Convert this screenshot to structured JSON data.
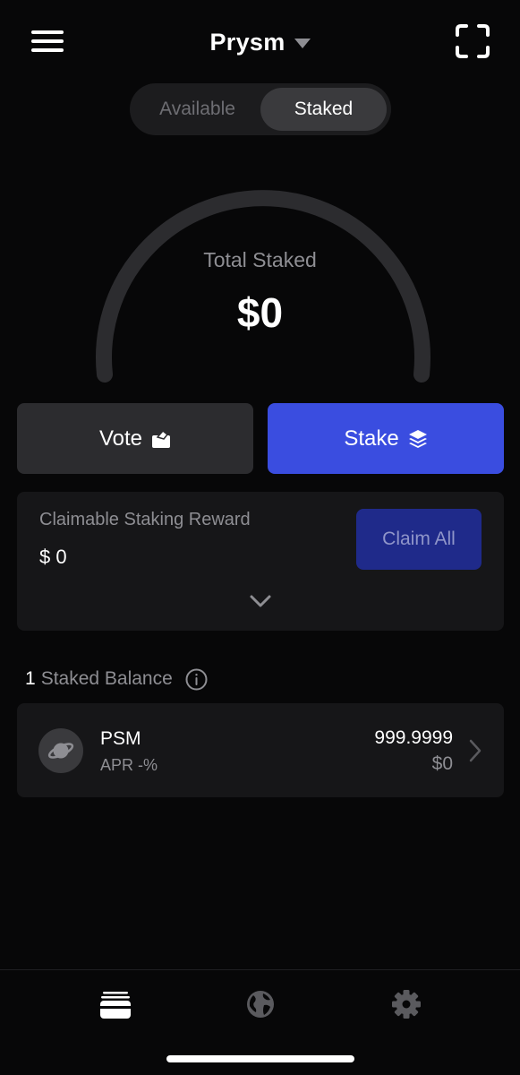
{
  "header": {
    "title": "Prysm",
    "menu_icon": "hamburger-menu-icon",
    "dropdown_icon": "caret-down-icon",
    "scan_icon": "scan-icon"
  },
  "segment": {
    "tabs": [
      {
        "label": "Available",
        "active": false
      },
      {
        "label": "Staked",
        "active": true
      }
    ]
  },
  "gauge": {
    "label": "Total Staked",
    "value": "$0",
    "progress": 0
  },
  "actions": {
    "vote_label": "Vote",
    "vote_icon": "ballot-box-icon",
    "stake_label": "Stake",
    "stake_icon": "layers-icon"
  },
  "reward": {
    "label": "Claimable Staking Reward",
    "value": "$ 0",
    "claim_label": "Claim All",
    "expand_icon": "chevron-down-icon"
  },
  "staked_balance": {
    "count": "1",
    "label": "Staked Balance",
    "info_icon": "info-icon",
    "tokens": [
      {
        "name": "PSM",
        "apr": "APR -%",
        "amount": "999.9999",
        "usd": "$0",
        "icon": "planet-icon"
      }
    ]
  },
  "tabbar": {
    "tabs": [
      {
        "name": "wallet",
        "icon": "wallet-icon",
        "active": true
      },
      {
        "name": "explore",
        "icon": "globe-icon",
        "active": false
      },
      {
        "name": "settings",
        "icon": "gear-icon",
        "active": false
      }
    ]
  },
  "colors": {
    "background": "#070708",
    "accent": "#3a4de0",
    "card": "#161618",
    "muted_text": "#8e8e93"
  }
}
